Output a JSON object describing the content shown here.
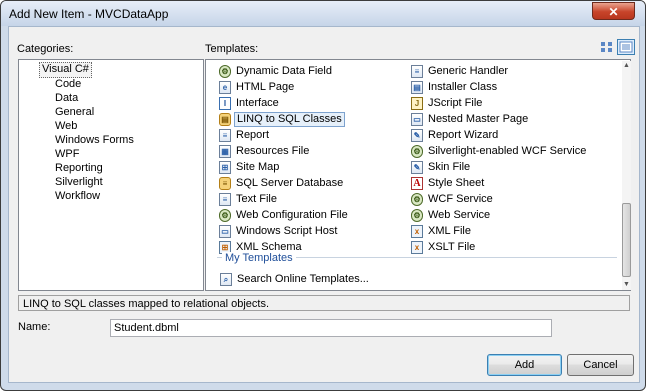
{
  "window": {
    "title": "Add New Item - MVCDataApp",
    "close_glyph": "✕"
  },
  "labels": {
    "categories": "Categories:",
    "templates": "Templates:",
    "name": "Name:"
  },
  "categories": [
    {
      "label": "Visual C#",
      "selected": true
    },
    {
      "label": "Code"
    },
    {
      "label": "Data"
    },
    {
      "label": "General"
    },
    {
      "label": "Web"
    },
    {
      "label": "Windows Forms"
    },
    {
      "label": "WPF"
    },
    {
      "label": "Reporting"
    },
    {
      "label": "Silverlight"
    },
    {
      "label": "Workflow"
    }
  ],
  "templates_left": [
    {
      "label": "Dynamic Data Field",
      "icon": "gear-icon"
    },
    {
      "label": "HTML Page",
      "icon": "html-page-icon"
    },
    {
      "label": "Interface",
      "icon": "interface-icon"
    },
    {
      "label": "LINQ to SQL Classes",
      "icon": "linq-classes-icon",
      "selected": true
    },
    {
      "label": "Report",
      "icon": "report-icon"
    },
    {
      "label": "Resources File",
      "icon": "resources-icon"
    },
    {
      "label": "Site Map",
      "icon": "sitemap-icon"
    },
    {
      "label": "SQL Server Database",
      "icon": "database-icon"
    },
    {
      "label": "Text File",
      "icon": "text-file-icon"
    },
    {
      "label": "Web Configuration File",
      "icon": "web-config-icon"
    },
    {
      "label": "Windows Script Host",
      "icon": "script-host-icon"
    },
    {
      "label": "XML Schema",
      "icon": "xml-schema-icon"
    }
  ],
  "templates_right": [
    {
      "label": "Generic Handler",
      "icon": "generic-handler-icon"
    },
    {
      "label": "Installer Class",
      "icon": "installer-icon"
    },
    {
      "label": "JScript File",
      "icon": "jscript-icon"
    },
    {
      "label": "Nested Master Page",
      "icon": "master-page-icon"
    },
    {
      "label": "Report Wizard",
      "icon": "report-wizard-icon"
    },
    {
      "label": "Silverlight-enabled WCF Service",
      "icon": "wcf-service-icon"
    },
    {
      "label": "Skin File",
      "icon": "skin-file-icon"
    },
    {
      "label": "Style Sheet",
      "icon": "stylesheet-icon"
    },
    {
      "label": "WCF Service",
      "icon": "wcf-service-icon"
    },
    {
      "label": "Web Service",
      "icon": "web-service-icon"
    },
    {
      "label": "XML File",
      "icon": "xml-file-icon"
    },
    {
      "label": "XSLT File",
      "icon": "xslt-file-icon"
    }
  ],
  "my_templates": {
    "label": "My Templates",
    "search": "Search Online Templates..."
  },
  "description": "LINQ to SQL classes mapped to relational objects.",
  "name_field": {
    "value": "Student.dbml"
  },
  "buttons": {
    "add": "Add",
    "cancel": "Cancel"
  },
  "colors": {
    "title_bar": "#c6d5e8",
    "selection": "#e6f0fa",
    "link_blue": "#1f4e99",
    "close_red": "#c7442a"
  }
}
